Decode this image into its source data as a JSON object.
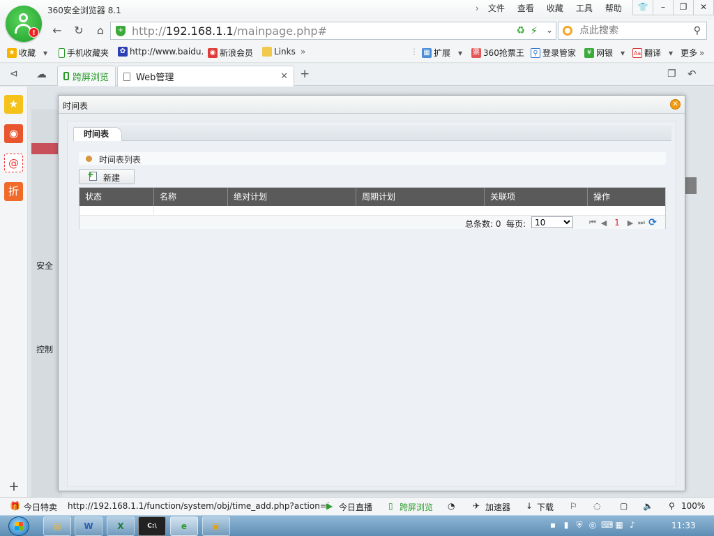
{
  "browser": {
    "title": "360安全浏览器 8.1",
    "menu": [
      "文件",
      "查看",
      "收藏",
      "工具",
      "帮助"
    ],
    "address": {
      "scheme": "http://",
      "host": "192.168.1.1",
      "path": "/mainpage.php#"
    },
    "search_placeholder": "点此搜索"
  },
  "bookmarks": {
    "left": [
      "收藏",
      "手机收藏夹",
      "http://www.baidu.",
      "新浪会员",
      "Links"
    ],
    "right": [
      "扩展",
      "360抢票王",
      "登录管家",
      "网银",
      "翻译",
      "更多"
    ]
  },
  "tabs": [
    {
      "label": "跨屏浏览"
    },
    {
      "label": "Web管理"
    }
  ],
  "page": {
    "sections": [
      "安全",
      "控制"
    ]
  },
  "dialog": {
    "title": "时间表",
    "tab_label": "时间表",
    "section_title": "时间表列表",
    "new_button": "新建",
    "columns": [
      "状态",
      "名称",
      "绝对计划",
      "周期计划",
      "关联项",
      "操作"
    ],
    "footer": {
      "total_label": "总条数: 0",
      "per_page_label": "每页:",
      "per_page_value": "10",
      "current_page": "1"
    }
  },
  "statusbar": {
    "today_deal": "今日特卖",
    "url": "http://192.168.1.1/function/system/obj/time_add.php?action=i",
    "live": "今日直播",
    "cross_screen": "跨屏浏览",
    "accelerator": "加速器",
    "download": "下载",
    "zoom": "100%"
  },
  "taskbar": {
    "time": "11:33"
  }
}
